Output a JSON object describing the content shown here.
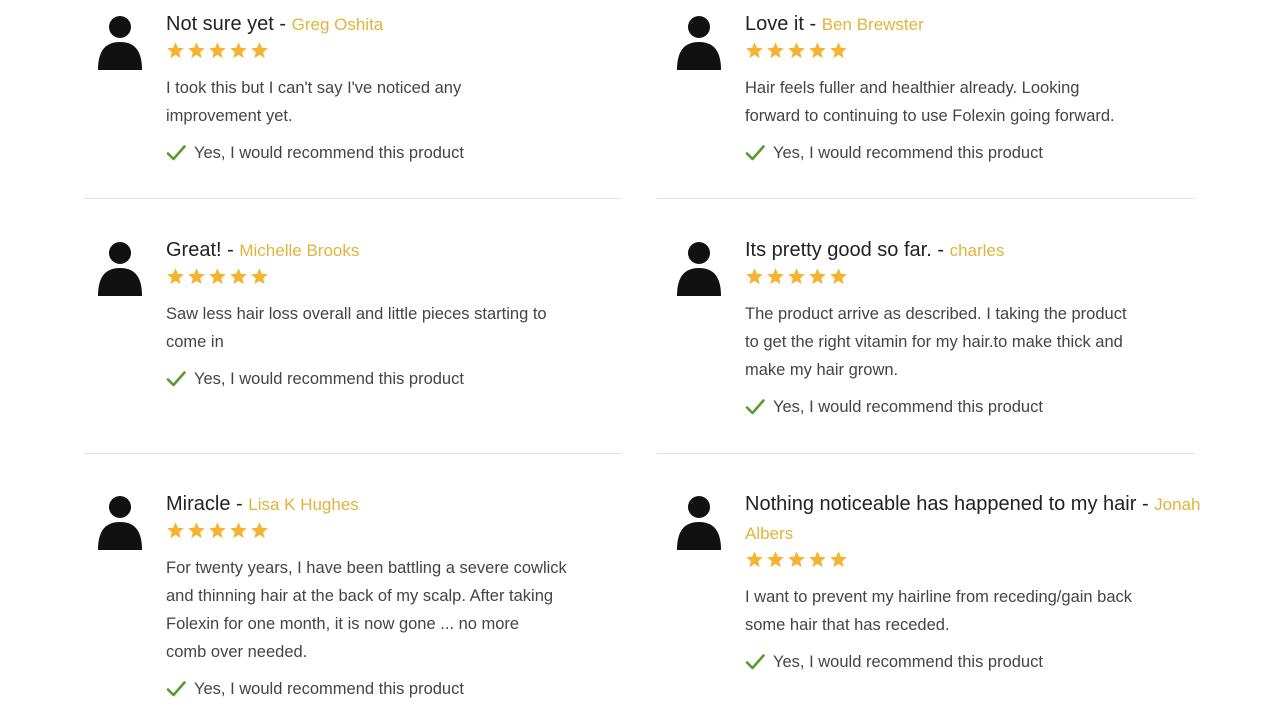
{
  "colors": {
    "author": "#e0b43a",
    "star": "#f5b332",
    "check": "#5a9a2e",
    "avatar": "#111111",
    "divider": "#e3e3e3"
  },
  "reviews": [
    {
      "title": "Not sure yet",
      "author": "Greg Oshita",
      "rating": 5,
      "body": [
        "I took this but I can't say I've noticed any",
        "improvement yet."
      ],
      "recommend": "Yes, I would recommend this product"
    },
    {
      "title": "Love it",
      "author": "Ben Brewster",
      "rating": 5,
      "body": [
        "Hair feels fuller and healthier already. Looking",
        "forward to continuing to use Folexin going forward."
      ],
      "recommend": "Yes, I would recommend this product"
    },
    {
      "title": "Great!",
      "author": "Michelle Brooks",
      "rating": 5,
      "body": [
        "Saw less hair loss overall and little pieces starting to",
        "come in"
      ],
      "recommend": "Yes, I would recommend this product"
    },
    {
      "title": "Its pretty good so far.",
      "author": "charles",
      "rating": 5,
      "body": [
        "The product arrive as described. I taking the product",
        "to get the right vitamin for my hair.to make thick and",
        "make my hair grown."
      ],
      "recommend": "Yes, I would recommend this product"
    },
    {
      "title": "Miracle",
      "author": "Lisa K Hughes",
      "rating": 5,
      "body": [
        "For twenty years, I have been battling a severe cowlick",
        "and thinning hair at the back of my scalp. After taking",
        "Folexin for one month, it is now gone ... no more",
        "comb over needed."
      ],
      "recommend": "Yes, I would recommend this product"
    },
    {
      "title": "Nothing noticeable has happened to my hair",
      "author": "Jonah Albers",
      "rating": 5,
      "body": [
        "I want to prevent my hairline from receding/gain back",
        "some hair that has receded."
      ],
      "recommend": "Yes, I would recommend this product"
    }
  ]
}
